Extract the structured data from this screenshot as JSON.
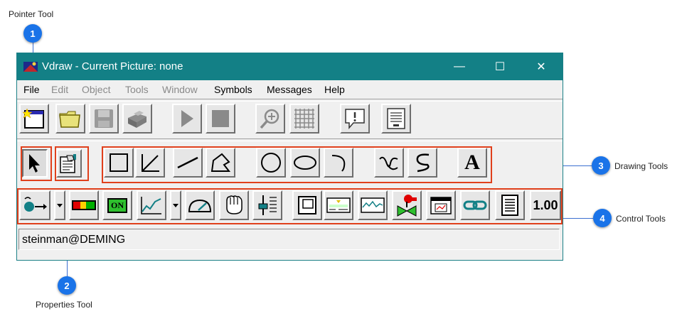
{
  "callouts": {
    "pointer_tool": "Pointer Tool",
    "properties_tool": "Properties Tool",
    "drawing_tools": "Drawing Tools",
    "control_tools": "Control Tools",
    "badge_1": "1",
    "badge_2": "2",
    "badge_3": "3",
    "badge_4": "4"
  },
  "window": {
    "title": "Vdraw - Current Picture: none",
    "minimize": "—",
    "maximize": "☐",
    "close": "✕"
  },
  "menu": [
    {
      "label": "File",
      "enabled": true
    },
    {
      "label": "Edit",
      "enabled": false
    },
    {
      "label": "Object",
      "enabled": false
    },
    {
      "label": "Tools",
      "enabled": false
    },
    {
      "label": "Window",
      "enabled": false
    },
    {
      "label": "Symbols",
      "enabled": true
    },
    {
      "label": "Messages",
      "enabled": true
    },
    {
      "label": "Help",
      "enabled": true
    }
  ],
  "toolbar_main": [
    "new-picture-icon",
    "open-folder-icon",
    "save-disk-icon",
    "print-icon",
    "play-icon",
    "stop-icon",
    "zoom-icon",
    "grid-icon",
    "message-icon",
    "document-icon"
  ],
  "toolbar_drawing": [
    "pointer-icon",
    "properties-icon",
    "rectangle-icon",
    "angle-line-icon",
    "line-icon",
    "polygon-icon",
    "circle-icon",
    "ellipse-icon",
    "arc-icon",
    "freehand-icon",
    "spline-icon",
    "text-icon"
  ],
  "text_tool_glyph": "A",
  "toolbar_controls": [
    "pointer-value-icon",
    "bar-indicator-icon",
    "on-button-icon",
    "trend-icon",
    "gauge-icon",
    "fist-icon",
    "slider-icon",
    "frame-icon",
    "panel-icon",
    "waveform-icon",
    "valve-icon",
    "window-icon",
    "link-icon",
    "list-icon",
    "numeric-icon"
  ],
  "on_label": "ON",
  "numeric_label": "1.00",
  "status": "steinman@DEMING",
  "colors": {
    "titlebar": "#138086",
    "callout_box": "#e0401c",
    "badge": "#1a73e8"
  }
}
